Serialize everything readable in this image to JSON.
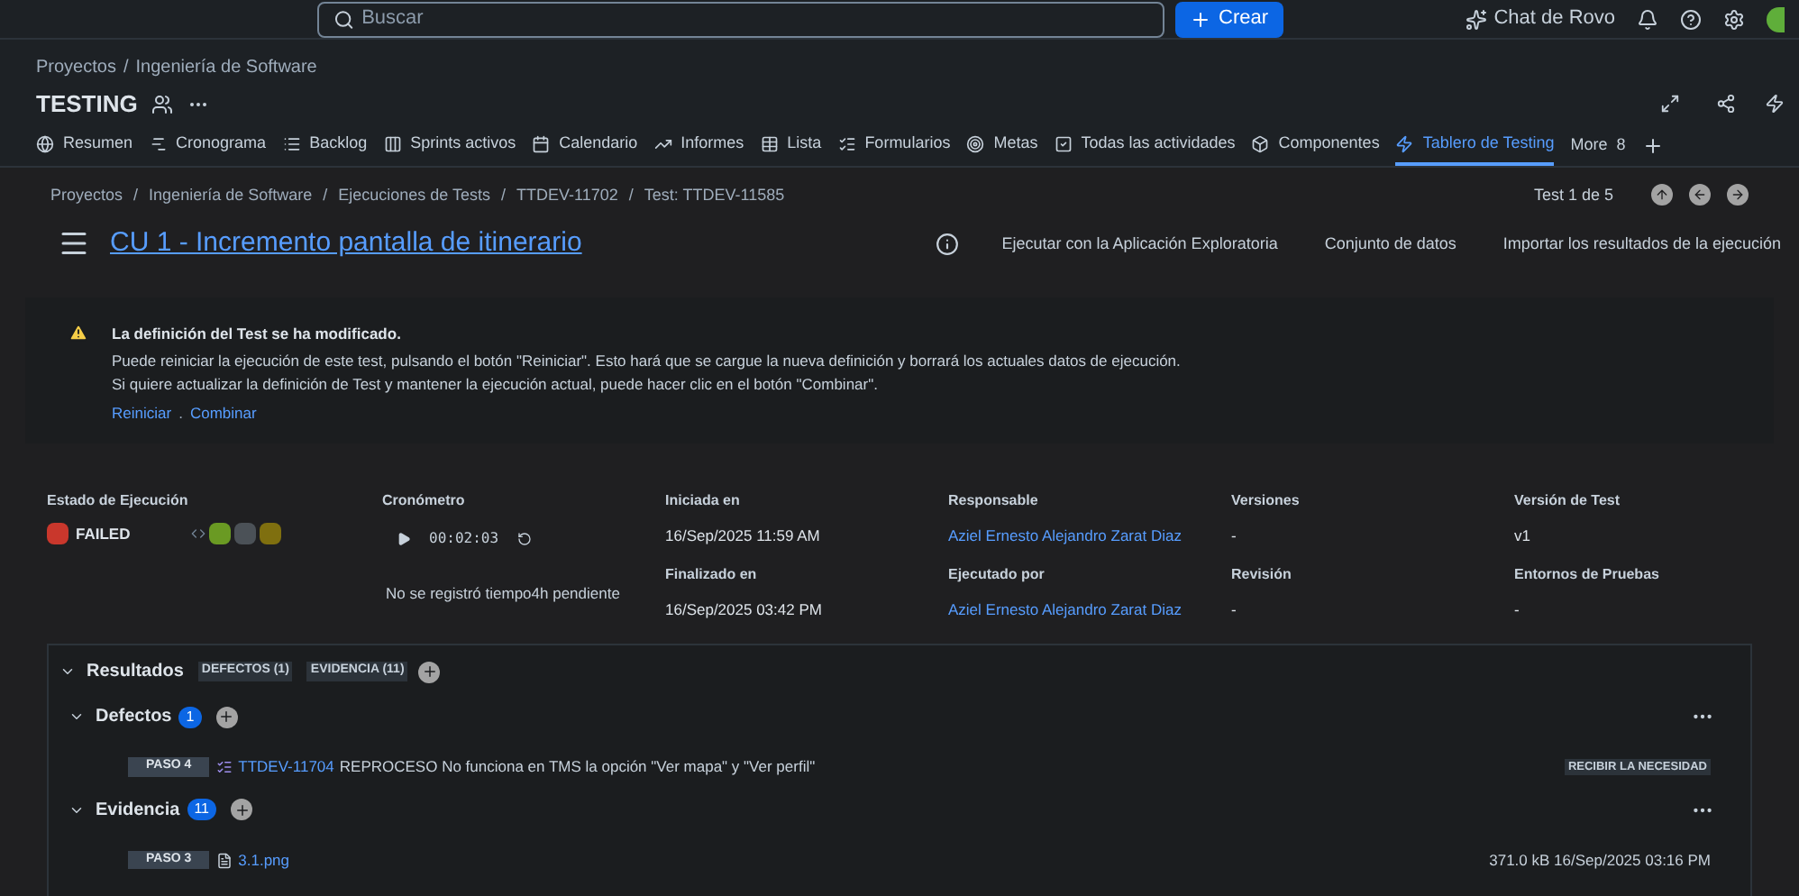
{
  "top_bar": {
    "search": {
      "placeholder": "Buscar"
    },
    "create_button": "Crear",
    "rovo": "Chat de Rovo"
  },
  "project": {
    "breadcrumb": [
      "Proyectos",
      "Ingeniería de Software"
    ],
    "separator": "/",
    "title": "TESTING",
    "tabs": [
      {
        "label": "Resumen",
        "selected": false
      },
      {
        "label": "Cronograma",
        "selected": false
      },
      {
        "label": "Backlog",
        "selected": false
      },
      {
        "label": "Sprints activos",
        "selected": false
      },
      {
        "label": "Calendario",
        "selected": false
      },
      {
        "label": "Informes",
        "selected": false
      },
      {
        "label": "Lista",
        "selected": false
      },
      {
        "label": "Formularios",
        "selected": false
      },
      {
        "label": "Metas",
        "selected": false
      },
      {
        "label": "Todas las actividades",
        "selected": false
      },
      {
        "label": "Componentes",
        "selected": false
      },
      {
        "label": "Tablero de Testing",
        "selected": true
      }
    ],
    "more": {
      "label": "More",
      "count": "8"
    }
  },
  "execution": {
    "separator": "/",
    "breadcrumb": [
      "Proyectos",
      "Ingeniería de Software",
      "Ejecuciones de Tests",
      "TTDEV-11702",
      "Test: TTDEV-11585"
    ],
    "pager": "Test 1 de 5",
    "title": "CU 1 - Incremento pantalla de itinerario",
    "actions": [
      "Ejecutar con la Aplicación Exploratoria",
      "Conjunto de datos",
      "Importar los resultados de la ejecución"
    ]
  },
  "alert": {
    "title": "La definición del Test se ha modificado.",
    "lines": [
      "Puede reiniciar la ejecución de este test, pulsando el botón \"Reiniciar\". Esto hará que se cargue la nueva definición y borrará los actuales datos de ejecución.",
      "Si quiere actualizar la definición de Test y mantener la ejecución actual, puede hacer clic en el botón \"Combinar\"."
    ],
    "links": [
      "Reiniciar",
      "Combinar"
    ],
    "separator": "."
  },
  "details": {
    "status_label": "Estado de Ejecución",
    "status": "FAILED",
    "swatches": [
      {
        "color": "#6a9a23"
      },
      {
        "color": "#4b5157"
      },
      {
        "color": "#7f6f0f"
      }
    ],
    "timer_label": "Cronómetro",
    "timer": "00:02:03",
    "timer_note": "No se registró tiempo4h pendiente",
    "fields": [
      {
        "label": "Iniciada en",
        "value": "16/Sep/2025 11:59 AM",
        "link": false
      },
      {
        "label": "Responsable",
        "value": "Aziel Ernesto Alejandro Zarat Diaz",
        "link": true
      },
      {
        "label": "Versiones",
        "value": "-",
        "link": false
      },
      {
        "label": "Versión de Test",
        "value": "v1",
        "link": false
      },
      {
        "label": "Finalizado en",
        "value": "16/Sep/2025 03:42 PM",
        "link": false
      },
      {
        "label": "Ejecutado por",
        "value": "Aziel Ernesto Alejandro Zarat Diaz",
        "link": true
      },
      {
        "label": "Revisión",
        "value": "-",
        "link": false
      },
      {
        "label": "Entornos de Pruebas",
        "value": "-",
        "link": false
      }
    ]
  },
  "results": {
    "title": "Resultados",
    "expanded": true,
    "tags": [
      "DEFECTOS (1)",
      "EVIDENCIA (11)"
    ],
    "sections": [
      {
        "title": "Defectos",
        "count": "1",
        "expanded": true,
        "rows": [
          {
            "kind": "defect",
            "step": "PASO 4",
            "key": "TTDEV-11704",
            "summary": "REPROCESO No funciona en TMS la opción \"Ver mapa\" y \"Ver perfil\"",
            "tag": "RECIBIR LA NECESIDAD"
          }
        ]
      },
      {
        "title": "Evidencia",
        "count": "11",
        "expanded": true,
        "rows": [
          {
            "kind": "file",
            "step": "PASO 3",
            "key": "3.1.png",
            "meta": "371.0 kB 16/Sep/2025 03:16 PM"
          }
        ]
      }
    ]
  }
}
